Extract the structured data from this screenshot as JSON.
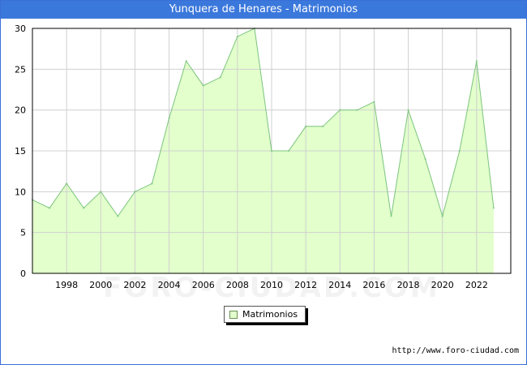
{
  "window": {
    "title": "Yunquera de Henares - Matrimonios"
  },
  "source_url": "http://www.foro-ciudad.com",
  "watermark": "FORO-CIUDAD.COM",
  "chart_data": {
    "type": "area",
    "title": "Yunquera de Henares - Matrimonios",
    "xlabel": "",
    "ylabel": "",
    "x": [
      1996,
      1997,
      1998,
      1999,
      2000,
      2001,
      2002,
      2003,
      2004,
      2005,
      2006,
      2007,
      2008,
      2009,
      2010,
      2011,
      2012,
      2013,
      2014,
      2015,
      2016,
      2017,
      2018,
      2019,
      2020,
      2021,
      2022,
      2023
    ],
    "series": [
      {
        "name": "Matrimonios",
        "values": [
          9,
          8,
          11,
          8,
          10,
          7,
          10,
          11,
          19,
          26,
          23,
          24,
          29,
          30,
          15,
          15,
          18,
          18,
          20,
          20,
          21,
          7,
          20,
          14,
          7,
          15,
          26,
          8
        ],
        "fill": "#e2ffcc",
        "stroke": "#7cc47c"
      }
    ],
    "xticks": [
      "1998",
      "2000",
      "2002",
      "2004",
      "2006",
      "2008",
      "2010",
      "2012",
      "2014",
      "2016",
      "2018",
      "2020",
      "2022"
    ],
    "yticks": [
      "0",
      "5",
      "10",
      "15",
      "20",
      "25",
      "30"
    ],
    "xlim": [
      1996,
      2024
    ],
    "ylim": [
      0,
      30
    ],
    "grid": true,
    "legend_position": "bottom-center"
  }
}
